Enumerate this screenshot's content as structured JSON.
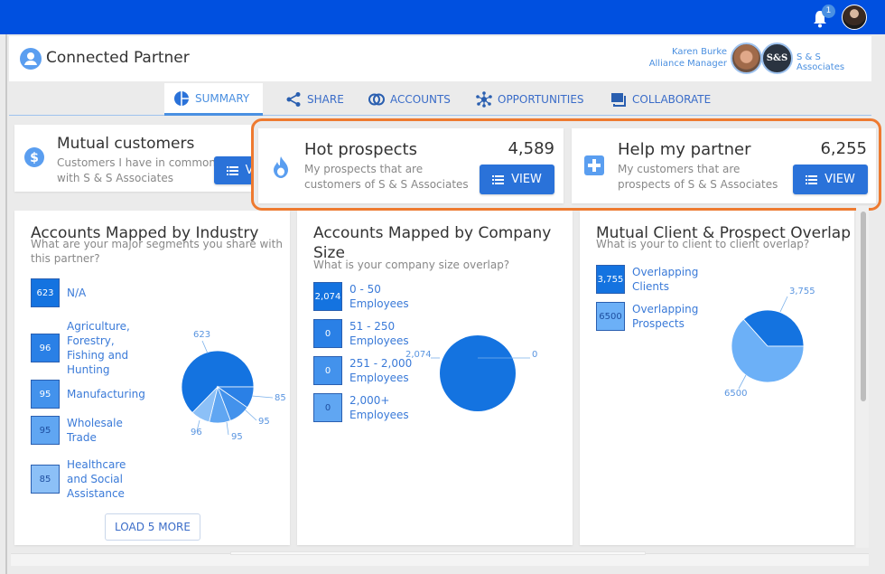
{
  "topbar": {
    "notification_count": "1",
    "user_avatar": "user-avatar"
  },
  "header": {
    "title": "Connected Partner",
    "manager_name": "Karen Burke",
    "manager_role": "Alliance Manager",
    "company_logo_text": "S&S",
    "company_name": "S & S Associates"
  },
  "tabs": [
    {
      "label": "SUMMARY",
      "icon": "pie-chart-icon",
      "active": true
    },
    {
      "label": "SHARE",
      "icon": "share-icon",
      "active": false
    },
    {
      "label": "ACCOUNTS",
      "icon": "overlap-circles-icon",
      "active": false
    },
    {
      "label": "OPPORTUNITIES",
      "icon": "network-icon",
      "active": false
    },
    {
      "label": "COLLABORATE",
      "icon": "chat-icon",
      "active": false
    }
  ],
  "stats": [
    {
      "title": "Mutual customers",
      "desc_line1": "Customers I have in common",
      "desc_line2": "with S & S Associates",
      "value": "",
      "button": "VIEW",
      "icon": "dollar-icon"
    },
    {
      "title": "Hot prospects",
      "desc_line1": "My prospects that are",
      "desc_line2": "customers of S & S Associates",
      "value": "4,589",
      "button": "VIEW",
      "icon": "flame-icon"
    },
    {
      "title": "Help my partner",
      "desc_line1": "My customers that are",
      "desc_line2": "prospects of S & S Associates",
      "value": "6,255",
      "button": "VIEW",
      "icon": "plus-icon"
    }
  ],
  "panels": {
    "industry": {
      "title": "Accounts Mapped by Industry",
      "subtitle_line1": "What are your major segments you share with",
      "subtitle_line2": "this partner?",
      "load_more": "LOAD 5 MORE"
    },
    "size": {
      "title_line1": "Accounts Mapped by Company",
      "title_line2": "Size",
      "subtitle": "What is your company size overlap?"
    },
    "overlap": {
      "title": "Mutual Client & Prospect Overlap",
      "subtitle": "What is your to client to client overlap?"
    }
  },
  "chart_data": [
    {
      "type": "pie",
      "title": "Accounts Mapped by Industry",
      "categories": [
        "N/A",
        "Agriculture, Forestry, Fishing and Hunting",
        "Manufacturing",
        "Wholesale Trade",
        "Healthcare and Social Assistance"
      ],
      "values": [
        623,
        96,
        95,
        95,
        85
      ],
      "value_labels": [
        "623",
        "96",
        "95",
        "95",
        "85"
      ],
      "label_lines": [
        [
          "N/A"
        ],
        [
          "Agriculture,",
          "Forestry,",
          "Fishing and",
          "Hunting"
        ],
        [
          "Manufacturing"
        ],
        [
          "Wholesale",
          "Trade"
        ],
        [
          "Healthcare",
          "and Social",
          "Assistance"
        ]
      ],
      "colors": [
        "#1473e0",
        "#2a80e6",
        "#4392ec",
        "#60a6f2",
        "#8cc0f7"
      ]
    },
    {
      "type": "pie",
      "title": "Accounts Mapped by Company Size",
      "categories": [
        "0 - 50 Employees",
        "51 - 250 Employees",
        "251 - 2,000 Employees",
        "2,000+ Employees"
      ],
      "values": [
        2074,
        0,
        0,
        0
      ],
      "value_labels": [
        "2,074",
        "0",
        "0",
        "0"
      ],
      "label_lines": [
        [
          "0 - 50",
          "Employees"
        ],
        [
          "51 - 250",
          "Employees"
        ],
        [
          "251 - 2,000",
          "Employees"
        ],
        [
          "2,000+",
          "Employees"
        ]
      ],
      "colors": [
        "#1473e0",
        "#2a80e6",
        "#4392ec",
        "#60a6f2"
      ]
    },
    {
      "type": "pie",
      "title": "Mutual Client & Prospect Overlap",
      "categories": [
        "Overlapping Clients",
        "Overlapping Prospects"
      ],
      "values": [
        3755,
        6500
      ],
      "value_labels": [
        "3,755",
        "6500"
      ],
      "label_lines": [
        [
          "Overlapping",
          "Clients"
        ],
        [
          "Overlapping",
          "Prospects"
        ]
      ],
      "colors": [
        "#1473e0",
        "#6cb0f7"
      ]
    }
  ]
}
